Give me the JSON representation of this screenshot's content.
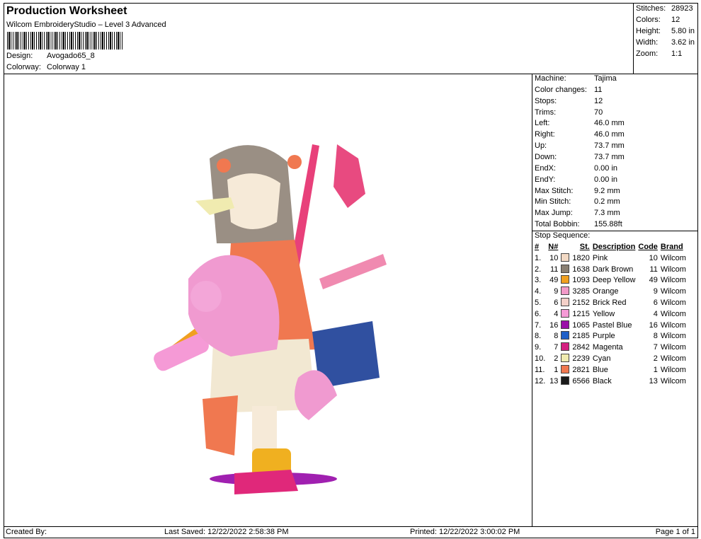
{
  "header": {
    "title": "Production Worksheet",
    "subtitle": "Wilcom EmbroideryStudio – Level 3 Advanced",
    "design_label": "Design:",
    "design_value": "Avogado65_8",
    "colorway_label": "Colorway:",
    "colorway_value": "Colorway 1"
  },
  "stats": [
    {
      "label": "Stitches:",
      "value": "28923"
    },
    {
      "label": "Colors:",
      "value": "12"
    },
    {
      "label": "Height:",
      "value": "5.80 in"
    },
    {
      "label": "Width:",
      "value": "3.62 in"
    },
    {
      "label": "Zoom:",
      "value": "1:1"
    }
  ],
  "info": [
    {
      "label": "Machine:",
      "value": "Tajima"
    },
    {
      "label": "Color changes:",
      "value": "11"
    },
    {
      "label": "Stops:",
      "value": "12"
    },
    {
      "label": "Trims:",
      "value": "70"
    },
    {
      "label": "Left:",
      "value": "46.0 mm"
    },
    {
      "label": "Right:",
      "value": "46.0 mm"
    },
    {
      "label": "Up:",
      "value": "73.7 mm"
    },
    {
      "label": "Down:",
      "value": "73.7 mm"
    },
    {
      "label": "EndX:",
      "value": "0.00 in"
    },
    {
      "label": "EndY:",
      "value": "0.00 in"
    },
    {
      "label": "Max Stitch:",
      "value": "9.2 mm"
    },
    {
      "label": "Min Stitch:",
      "value": "0.2 mm"
    },
    {
      "label": "Max Jump:",
      "value": "7.3 mm"
    },
    {
      "label": "Total Bobbin:",
      "value": "155.88ft"
    }
  ],
  "stop_sequence": {
    "title": "Stop Sequence:",
    "headers": {
      "num": "#",
      "n": "N#",
      "st": "St.",
      "desc": "Description",
      "code": "Code",
      "brand": "Brand"
    },
    "rows": [
      {
        "num": "1.",
        "n": "10",
        "color": "#f2d9c4",
        "st": "1820",
        "desc": "Pink",
        "code": "10",
        "brand": "Wilcom"
      },
      {
        "num": "2.",
        "n": "11",
        "color": "#8a7f72",
        "st": "1638",
        "desc": "Dark Brown",
        "code": "11",
        "brand": "Wilcom"
      },
      {
        "num": "3.",
        "n": "49",
        "color": "#f0a020",
        "st": "1093",
        "desc": "Deep Yellow",
        "code": "49",
        "brand": "Wilcom"
      },
      {
        "num": "4.",
        "n": "9",
        "color": "#f29ac8",
        "st": "3285",
        "desc": "Orange",
        "code": "9",
        "brand": "Wilcom"
      },
      {
        "num": "5.",
        "n": "6",
        "color": "#f4d0c8",
        "st": "2152",
        "desc": "Brick Red",
        "code": "6",
        "brand": "Wilcom"
      },
      {
        "num": "6.",
        "n": "4",
        "color": "#f59ad6",
        "st": "1215",
        "desc": "Yellow",
        "code": "4",
        "brand": "Wilcom"
      },
      {
        "num": "7.",
        "n": "16",
        "color": "#9a10a8",
        "st": "1065",
        "desc": "Pastel Blue",
        "code": "16",
        "brand": "Wilcom"
      },
      {
        "num": "8.",
        "n": "8",
        "color": "#2060c8",
        "st": "2185",
        "desc": "Purple",
        "code": "8",
        "brand": "Wilcom"
      },
      {
        "num": "9.",
        "n": "7",
        "color": "#d42080",
        "st": "2842",
        "desc": "Magenta",
        "code": "7",
        "brand": "Wilcom"
      },
      {
        "num": "10.",
        "n": "2",
        "color": "#f0ebb0",
        "st": "2239",
        "desc": "Cyan",
        "code": "2",
        "brand": "Wilcom"
      },
      {
        "num": "11.",
        "n": "1",
        "color": "#f07850",
        "st": "2821",
        "desc": "Blue",
        "code": "1",
        "brand": "Wilcom"
      },
      {
        "num": "12.",
        "n": "13",
        "color": "#1a1a1a",
        "st": "6566",
        "desc": "Black",
        "code": "13",
        "brand": "Wilcom"
      }
    ]
  },
  "footer": {
    "created_by": "Created By:",
    "last_saved": "Last Saved: 12/22/2022 2:58:38 PM",
    "printed": "Printed: 12/22/2022 3:00:02 PM",
    "page": "Page 1 of 1"
  }
}
